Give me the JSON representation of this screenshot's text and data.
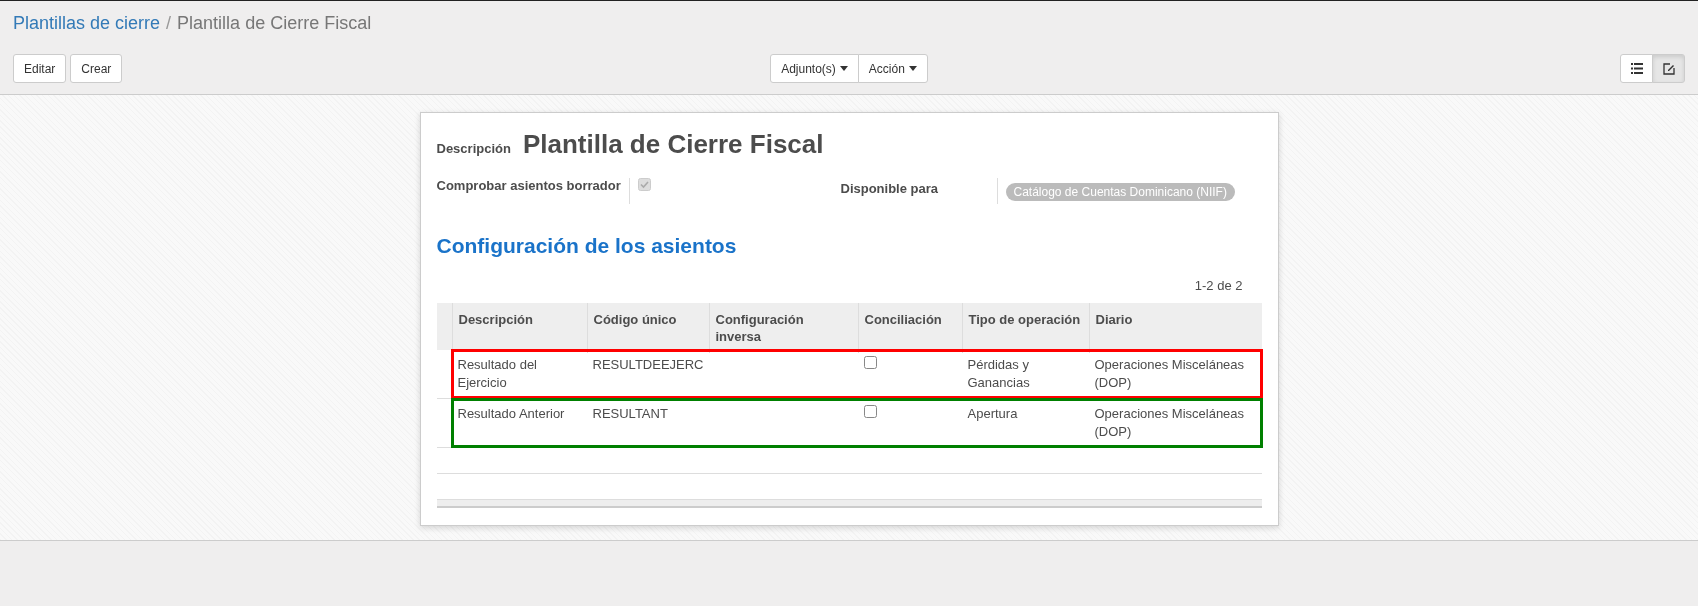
{
  "breadcrumb": {
    "parent": "Plantillas de cierre",
    "separator": "/",
    "current": "Plantilla de Cierre Fiscal"
  },
  "buttons": [
    "Editar",
    "Crear"
  ],
  "dropdowns": [
    "Adjunto(s)",
    "Acción"
  ],
  "view_switcher": [
    {
      "kind": "list",
      "selected": false
    },
    {
      "kind": "form",
      "selected": true
    }
  ],
  "form": {
    "title_label": "Descripción",
    "title": "Plantilla de Cierre Fiscal",
    "check_label": "Comprobar asientos borrador",
    "check_checked": true,
    "available_label": "Disponible para",
    "available_tag": "Catálogo de Cuentas Dominicano (NIIF)",
    "section": "Configuración de los asientos",
    "pager": "1-2 de 2",
    "columns": [
      "Descripción",
      "Código único",
      "Configuración inversa",
      "Conciliación",
      "Tipo de operación",
      "Diario"
    ],
    "rows": [
      {
        "description": "Resultado del Ejercicio",
        "code": "RESULTDEEJERC",
        "reconcile": false,
        "operation": "Pérdidas y Ganancias",
        "journal": "Operaciones Misceláneas (DOP)",
        "color": "#ff0000"
      },
      {
        "description": "Resultado Anterior",
        "code": "RESULTANT",
        "reconcile": false,
        "operation": "Apertura",
        "journal": "Operaciones Misceláneas (DOP)",
        "color": "#008000"
      }
    ]
  }
}
